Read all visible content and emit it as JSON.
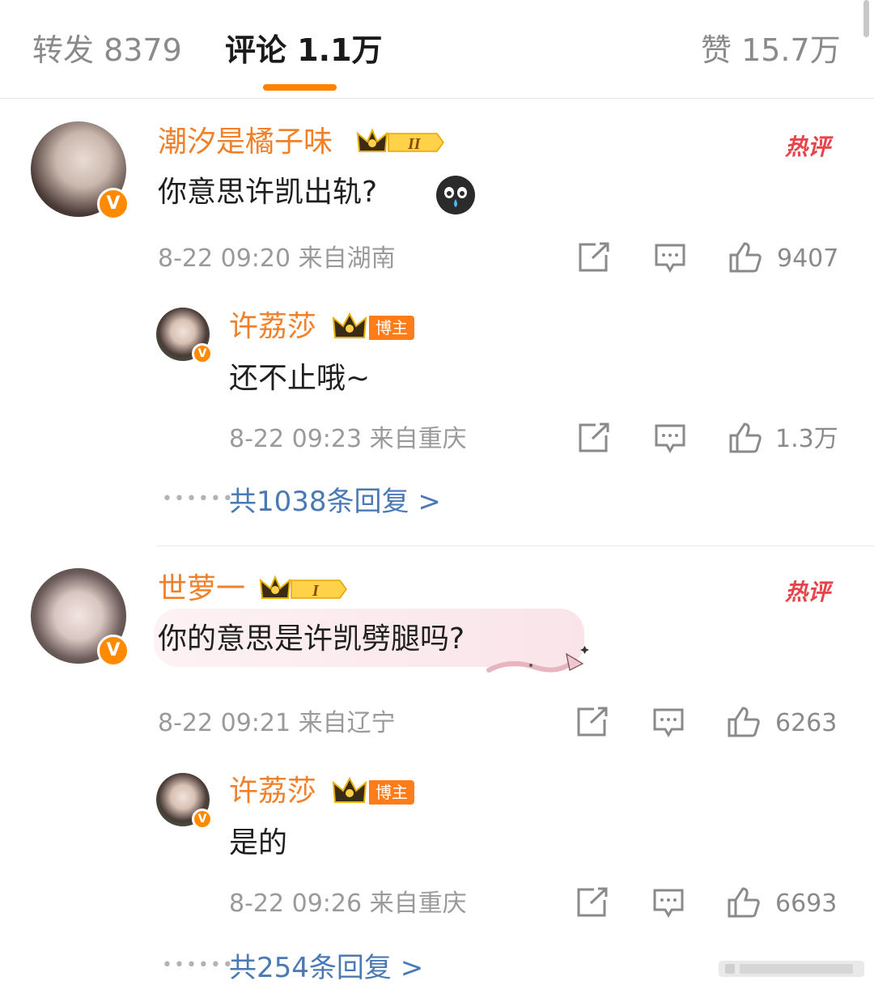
{
  "tabs": {
    "repost": "转发 8379",
    "comments": "评论 1.1万",
    "likes": "赞 15.7万"
  },
  "colors": {
    "accent": "#ff8200",
    "username": "#f28029",
    "link": "#4a7ab5",
    "hot": "#e8434a"
  },
  "comments": [
    {
      "username": "潮汐是橘子味",
      "level_badge": "II",
      "hot_label": "热评",
      "text": "你意思许凯出轨?",
      "emoji": "crying-emoji",
      "meta": "8-22 09:20 来自湖南",
      "likes": "9407",
      "reply": {
        "username": "许荔莎",
        "tag": "博主",
        "text": "还不止哦~",
        "meta": "8-22 09:23 来自重庆",
        "likes": "1.3万"
      },
      "more_replies": "共1038条回复 >"
    },
    {
      "username": "世萝一",
      "level_badge": "I",
      "hot_label": "热评",
      "text": "你的意思是许凯劈腿吗?",
      "meta": "8-22 09:21 来自辽宁",
      "likes": "6263",
      "reply": {
        "username": "许荔莎",
        "tag": "博主",
        "text": "是的",
        "meta": "8-22 09:26 来自重庆",
        "likes": "6693"
      },
      "more_replies": "共254条回复 >"
    }
  ],
  "icons": {
    "share": "share-icon",
    "comment": "comment-icon",
    "like": "thumbs-up-icon",
    "verified": "verified-v-icon",
    "crown": "crown-icon"
  }
}
